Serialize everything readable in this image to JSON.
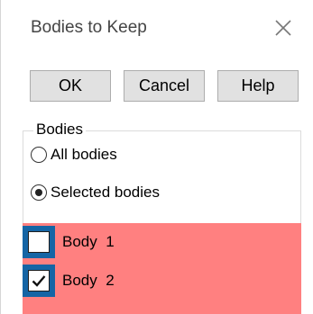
{
  "dialog": {
    "title": "Bodies to Keep"
  },
  "buttons": {
    "ok": "OK",
    "cancel": "Cancel",
    "help": "Help"
  },
  "bodies_group": {
    "label": "Bodies",
    "options": [
      {
        "label": "All bodies",
        "selected": false
      },
      {
        "label": "Selected bodies",
        "selected": true
      }
    ]
  },
  "body_list": {
    "highlight_color": "#ff8080",
    "items": [
      {
        "label": "Body  1",
        "checked": false
      },
      {
        "label": "Body  2",
        "checked": true
      }
    ]
  }
}
